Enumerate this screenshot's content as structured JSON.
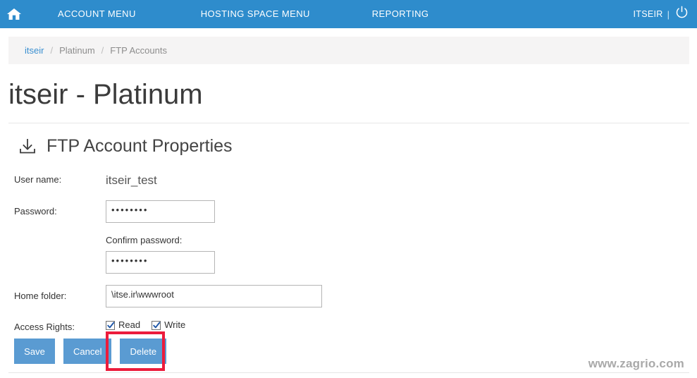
{
  "topnav": {
    "home_icon": "home-icon",
    "items": [
      {
        "label": "ACCOUNT MENU"
      },
      {
        "label": "HOSTING SPACE MENU"
      },
      {
        "label": "REPORTING"
      }
    ],
    "user": "ITSEIR",
    "separator": "|",
    "logout_icon": "power-icon",
    "background_color": "#2e8ccc"
  },
  "breadcrumb": {
    "items": [
      {
        "label": "itseir",
        "link": true
      },
      {
        "label": "Platinum",
        "link": false
      },
      {
        "label": "FTP Accounts",
        "link": false
      }
    ],
    "separator": "/"
  },
  "page": {
    "title": "itseir - Platinum"
  },
  "section": {
    "icon": "download-icon",
    "title": "FTP Account Properties"
  },
  "form": {
    "username": {
      "label": "User name:",
      "value": "itseir_test"
    },
    "password": {
      "label": "Password:",
      "value": "••••••••",
      "masked_length": 8
    },
    "confirm_password": {
      "label": "Confirm password:",
      "value": "••••••••",
      "masked_length": 8
    },
    "home_folder": {
      "label": "Home folder:",
      "value": "\\itse.ir\\wwwroot"
    },
    "access_rights": {
      "label": "Access Rights:",
      "options": [
        {
          "label": "Read",
          "checked": true
        },
        {
          "label": "Write",
          "checked": true
        }
      ]
    }
  },
  "buttons": {
    "save": "Save",
    "cancel": "Cancel",
    "delete": "Delete",
    "color": "#5a9bd2",
    "highlight_color": "#ec1c3c",
    "highlighted": "Delete"
  },
  "footer": {
    "watermark": "www.zagrio.com"
  }
}
